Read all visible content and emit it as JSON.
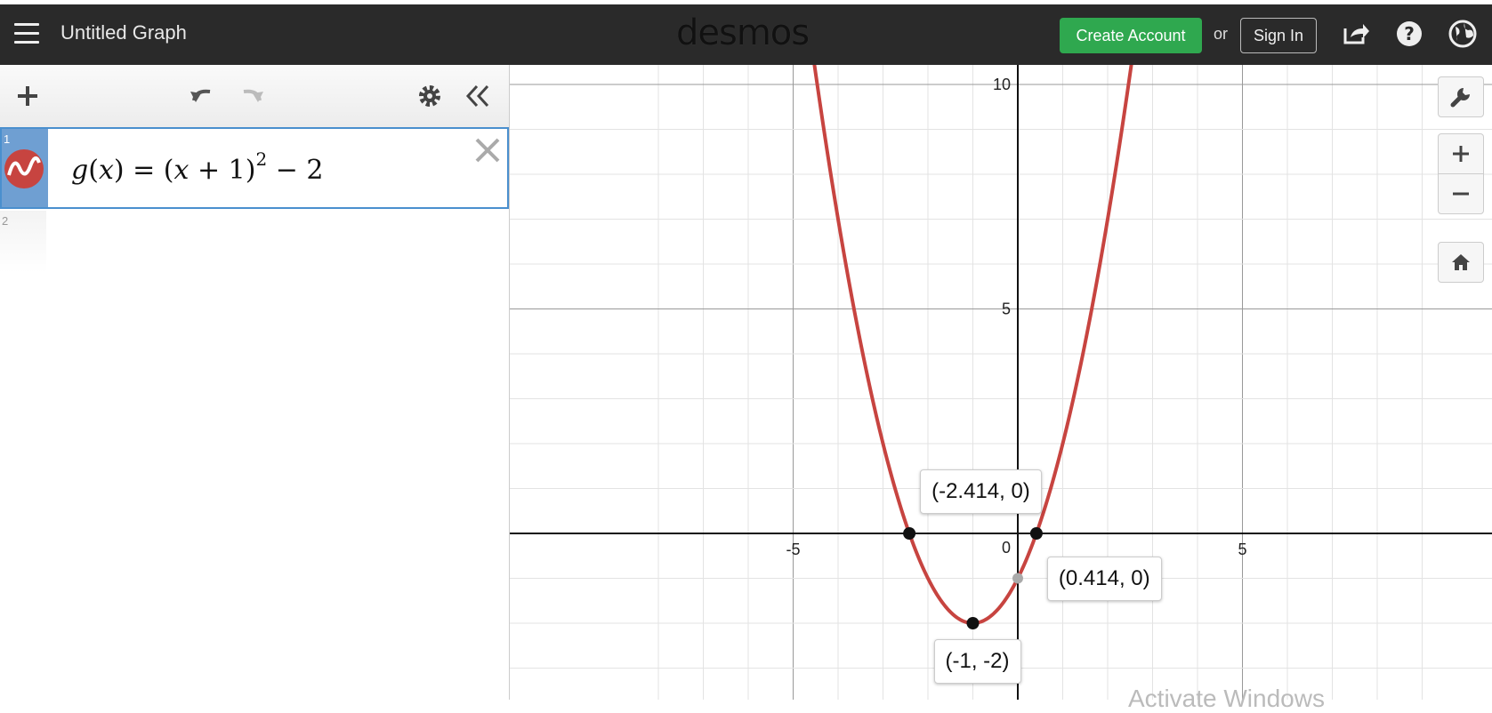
{
  "header": {
    "title": "Untitled Graph",
    "logo": "desmos",
    "create_account": "Create Account",
    "or": "or",
    "sign_in": "Sign In"
  },
  "expressions": [
    {
      "index": "1",
      "color": "#c74440",
      "latex_parts": {
        "name": "g",
        "var": "x",
        "eq": "=",
        "open": "(",
        "plus": "+ 1)",
        "exp": "2",
        "minus": "− 2"
      }
    },
    {
      "index": "2"
    }
  ],
  "graph": {
    "axis_ticks": {
      "x": [
        "-5",
        "5"
      ],
      "y": [
        "10",
        "5"
      ],
      "origin": "0"
    },
    "points": [
      {
        "label": "(-2.414, 0)",
        "x": -2.414,
        "y": 0
      },
      {
        "label": "(0.414, 0)",
        "x": 0.414,
        "y": 0
      },
      {
        "label": "(-1, -2)",
        "x": -1,
        "y": -2
      }
    ],
    "y_intercept": {
      "x": 0,
      "y": -1
    }
  },
  "chart_data": {
    "type": "line",
    "series": [
      {
        "name": "g(x) = (x+1)^2 - 2"
      }
    ],
    "function": "(x+1)^2 - 2",
    "xlim": [
      -8.4,
      9
    ],
    "ylim": [
      -3.7,
      10.5
    ],
    "grid": true
  },
  "watermark": "Activate Windows"
}
